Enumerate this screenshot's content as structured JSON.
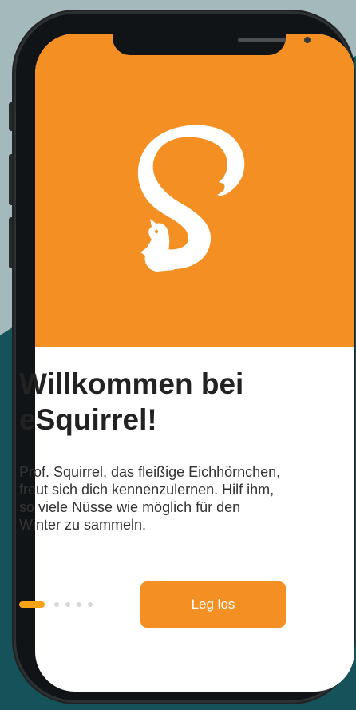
{
  "onboarding": {
    "title": "Willkommen bei eSquirrel!",
    "description": "Prof. Squirrel, das fleißige Eichhörnchen, freut sich dich kennenzulernen. Hilf ihm, so viele Nüsse wie möglich für den Winter zu sammeln.",
    "cta_label": "Leg los",
    "page_indicator": {
      "current_page": 1,
      "total_pages": 5
    }
  },
  "colors": {
    "background_teal": "#16525a",
    "wave_light": "#a3b9bb",
    "accent_orange": "#f49023",
    "indicator_active": "#f6a316",
    "indicator_inactive": "#d7d7d7",
    "title_text": "#222222"
  },
  "icons": {
    "logo": "esquirrel-squirrel-logo-icon"
  }
}
